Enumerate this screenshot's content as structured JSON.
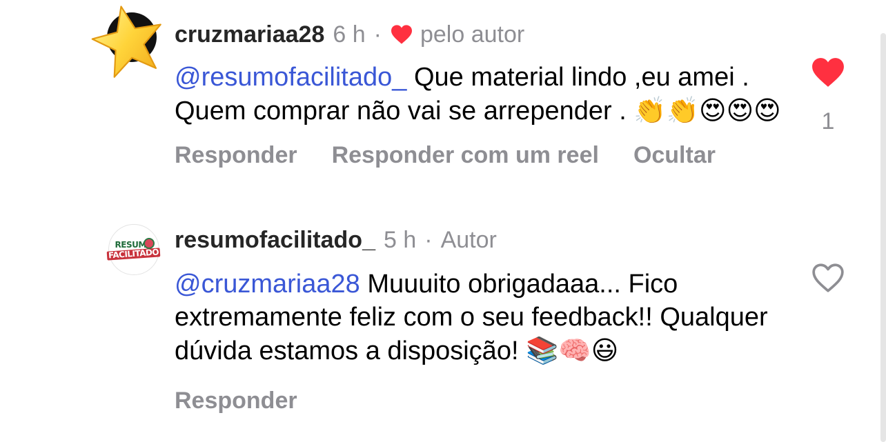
{
  "comments": [
    {
      "username": "cruzmariaa28",
      "time": "6 h",
      "separator": "·",
      "liked_by_author_label": "pelo autor",
      "avatar_icon": "star-icon",
      "mention": "@resumofacilitado_",
      "text": " Que material lindo ,eu amei . Quem comprar não vai se arrepender . ",
      "emojis": "👏👏😍😍😍",
      "like_icon": "heart-filled-icon",
      "like_color": "#ff3040",
      "like_count": "1",
      "actions": {
        "reply": "Responder",
        "reply_reel": "Responder com um reel",
        "hide": "Ocultar"
      }
    },
    {
      "username": "resumofacilitado_",
      "time": "5 h",
      "separator": "·",
      "author_label": "Autor",
      "avatar_logo_line1": "RESUMO",
      "avatar_logo_line2": "FACILITADO",
      "mention": "@cruzmariaa28",
      "text": " Muuuito obrigadaaa... Fico extremamente feliz com o seu feedback!! Qualquer dúvida estamos a disposição! ",
      "emojis": "📚🧠😃",
      "like_icon": "heart-outline-icon",
      "actions": {
        "reply": "Responder"
      }
    }
  ],
  "colors": {
    "mention": "#3a57d6",
    "secondary_text": "#8e8e93",
    "like_red": "#ff3040"
  }
}
